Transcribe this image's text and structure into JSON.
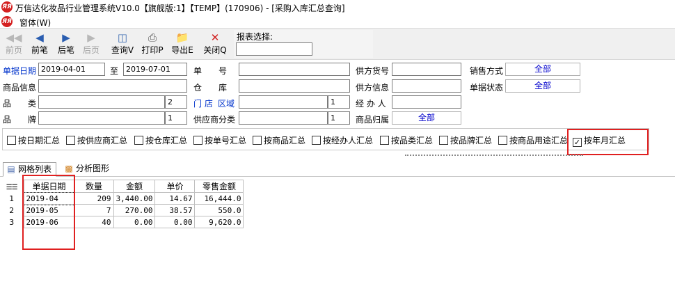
{
  "window": {
    "title": "万信达化妆品行业管理系统V10.0【旗舰版:1】【TEMP】(170906) - [采购入库汇总查询]",
    "menu_window": "窗体(W)"
  },
  "toolbar": {
    "prev_page": "前页",
    "prev_record": "前笔",
    "next_record": "后笔",
    "next_page": "后页",
    "query": "查询V",
    "print": "打印P",
    "export": "导出E",
    "close": "关闭Q",
    "report_select_label": "报表选择:",
    "report_select_value": ""
  },
  "filters": {
    "doc_date_label": "单据日期",
    "doc_date_from": "2019-04-01",
    "to_label": "至",
    "doc_date_to": "2019-07-01",
    "doc_no_label": "单　　号",
    "doc_no_value": "",
    "supplier_code_label": "供方货号",
    "supplier_code_value": "",
    "sales_mode_label": "销售方式",
    "sales_mode_value": "全部",
    "product_info_label": "商品信息",
    "product_info_value": "",
    "warehouse_label": "仓　　库",
    "warehouse_value": "",
    "supplier_info_label": "供方信息",
    "supplier_info_value": "",
    "doc_status_label": "单据状态",
    "doc_status_value": "全部",
    "category_label": "品　　类",
    "category_value": "",
    "category_level": "2",
    "store_label": "门 店",
    "region_label": "区域",
    "store_value": "",
    "store_level": "1",
    "handler_label": "经 办 人",
    "handler_value": "",
    "brand_label": "品　　牌",
    "brand_value": "",
    "brand_level": "1",
    "supplier_class_label": "供应商分类",
    "supplier_class_value": "",
    "supplier_class_level": "1",
    "product_owner_label": "商品归属",
    "product_owner_value": "全部"
  },
  "summary_options": [
    {
      "label": "按日期汇总",
      "checked": false
    },
    {
      "label": "按供应商汇总",
      "checked": false
    },
    {
      "label": "按仓库汇总",
      "checked": false
    },
    {
      "label": "按单号汇总",
      "checked": false
    },
    {
      "label": "按商品汇总",
      "checked": false
    },
    {
      "label": "按经办人汇总",
      "checked": false
    },
    {
      "label": "按品类汇总",
      "checked": false
    },
    {
      "label": "按品牌汇总",
      "checked": false
    },
    {
      "label": "按商品用途汇总",
      "checked": false
    },
    {
      "label": "按年月汇总",
      "checked": true
    }
  ],
  "tabs": {
    "grid": "网格列表",
    "chart": "分析图形"
  },
  "grid": {
    "columns": [
      "单据日期",
      "数量",
      "金额",
      "单价",
      "零售金额"
    ],
    "rows": [
      {
        "no": "1",
        "date": "2019-04",
        "qty": "209",
        "amount": "3,440.00",
        "price": "14.67",
        "retail": "16,444.0"
      },
      {
        "no": "2",
        "date": "2019-05",
        "qty": "7",
        "amount": "270.00",
        "price": "38.57",
        "retail": "550.0"
      },
      {
        "no": "3",
        "date": "2019-06",
        "qty": "40",
        "amount": "0.00",
        "price": "0.00",
        "retail": "9,620.0"
      }
    ]
  },
  "check_mark": "✓",
  "accent_color": "#e02020"
}
